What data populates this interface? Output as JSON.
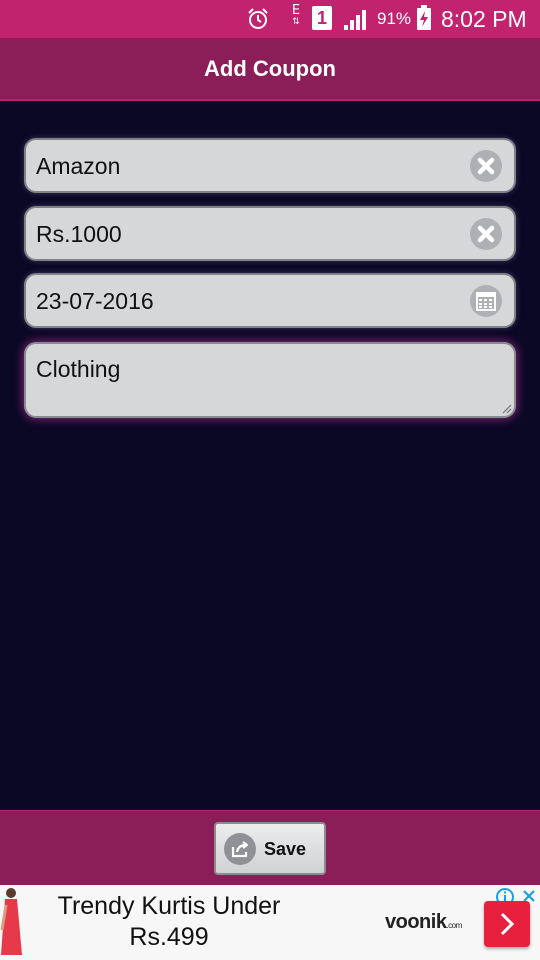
{
  "status_bar": {
    "network_type": "E",
    "sim_slot": "1",
    "battery_percent": "91%",
    "time": "8:02 PM",
    "icons": [
      "alarm-icon",
      "network-e-icon",
      "sim-1-icon",
      "signal-icon",
      "battery-charging-icon"
    ]
  },
  "app_bar": {
    "title": "Add Coupon"
  },
  "form": {
    "store": {
      "value": "Amazon",
      "action_icon": "clear-icon"
    },
    "amount": {
      "value": "Rs.1000",
      "action_icon": "clear-icon"
    },
    "expiry_date": {
      "value": "23-07-2016",
      "action_icon": "calendar-icon"
    },
    "category": {
      "value": "Clothing"
    }
  },
  "bottom_bar": {
    "save_label": "Save",
    "save_icon": "share-export-icon"
  },
  "ad": {
    "headline": "Trendy Kurtis Under Rs.499",
    "brand": "voonik",
    "brand_domain": ".com",
    "colors": {
      "cta": "#e6203d",
      "info": "#1aa0e0"
    }
  },
  "colors": {
    "status_bar": "#c2236f",
    "app_bar": "#8b1d59",
    "background": "#0b0826",
    "field": "#d5d7d9"
  }
}
